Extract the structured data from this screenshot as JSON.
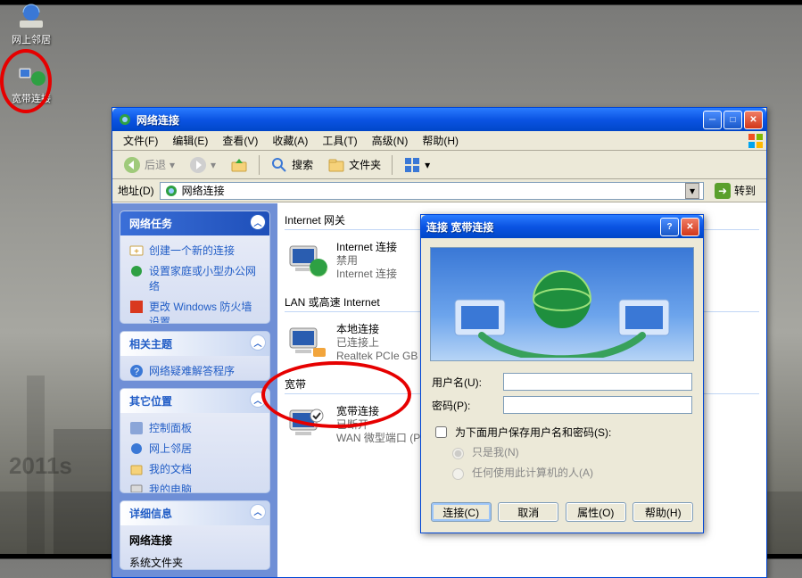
{
  "desktop": {
    "icons": [
      {
        "label": "网上邻居"
      },
      {
        "label": "宽带连接"
      }
    ]
  },
  "explorer": {
    "title": "网络连接",
    "menubar": [
      "文件(F)",
      "编辑(E)",
      "查看(V)",
      "收藏(A)",
      "工具(T)",
      "高级(N)",
      "帮助(H)"
    ],
    "toolbar": {
      "back": "后退",
      "search": "搜索",
      "folders": "文件夹"
    },
    "addressbar": {
      "label": "地址(D)",
      "value": "网络连接",
      "go": "转到"
    },
    "sidebar": {
      "tasks": {
        "title": "网络任务",
        "items": [
          "创建一个新的连接",
          "设置家庭或小型办公网络",
          "更改 Windows 防火墙设置"
        ]
      },
      "related": {
        "title": "相关主题",
        "items": [
          "网络疑难解答程序"
        ]
      },
      "other_places": {
        "title": "其它位置",
        "items": [
          "控制面板",
          "网上邻居",
          "我的文档",
          "我的电脑"
        ]
      },
      "details": {
        "title": "详细信息",
        "name": "网络连接",
        "desc": "系统文件夹"
      }
    },
    "main": {
      "sections": {
        "gateway": {
          "label": "Internet 网关",
          "items": [
            {
              "name": "Internet 连接",
              "status": "禁用",
              "sub2": "Internet 连接"
            }
          ]
        },
        "lan": {
          "label": "LAN 或高速 Internet",
          "items": [
            {
              "name": "本地连接",
              "status": "已连接上",
              "sub2": "Realtek PCIe GB"
            }
          ]
        },
        "broadband": {
          "label": "宽带",
          "items": [
            {
              "name": "宽带连接",
              "status": "已断开",
              "sub2": "WAN 微型端口 (P"
            }
          ]
        }
      }
    }
  },
  "dialog": {
    "title": "连接 宽带连接",
    "fields": {
      "username_label": "用户名(U):",
      "username_value": "",
      "password_label": "密码(P):",
      "password_value": ""
    },
    "checkbox": {
      "label": "为下面用户保存用户名和密码(S):"
    },
    "radios": {
      "me_only": "只是我(N)",
      "anyone": "任何使用此计算机的人(A)"
    },
    "buttons": {
      "connect": "连接(C)",
      "cancel": "取消",
      "properties": "属性(O)",
      "help": "帮助(H)"
    }
  }
}
